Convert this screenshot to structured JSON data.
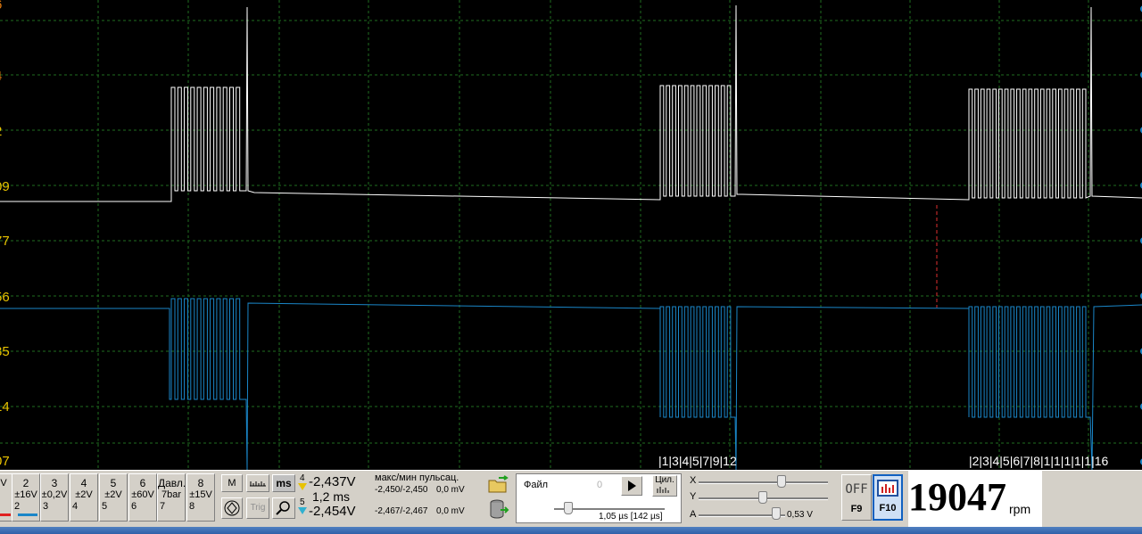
{
  "scope": {
    "y_labels": [
      "6",
      "4",
      "2",
      "09",
      "77",
      "56",
      "35",
      "14",
      "07"
    ],
    "marker_groups": [
      "|1|3|4|5|7|9|12",
      "|2|3|4|5|6|7|8|1|1|1|1|1|16"
    ],
    "colors": {
      "trace1": "#ffffff",
      "trace2": "#1a86c8",
      "grid": "#1f6e1f",
      "label": "#e8c200",
      "label_top": "#e07a10"
    }
  },
  "channels": [
    {
      "num": "",
      "range": "V",
      "idx": ""
    },
    {
      "num": "2",
      "range": "±16V",
      "idx": "2"
    },
    {
      "num": "3",
      "range": "±0,2V",
      "idx": "3"
    },
    {
      "num": "4",
      "range": "±2V",
      "idx": "4"
    },
    {
      "num": "5",
      "range": "±2V",
      "idx": "5"
    },
    {
      "num": "6",
      "range": "±60V",
      "idx": "6"
    },
    {
      "num": "Давл.",
      "range": "7bar",
      "idx": "7"
    },
    {
      "num": "8",
      "range": "±15V",
      "idx": "8"
    }
  ],
  "tools": {
    "m_label": "M",
    "ms_label": "ms",
    "trig_label": "Trig"
  },
  "measure": {
    "cursor1_num": "4",
    "cursor1_value": "-2,437V",
    "delta_time": "1,2 ms",
    "cursor2_num": "5",
    "cursor2_value": "-2,454V",
    "header": "макс/мин  пульсац.",
    "row1_minmax": "-2,450/-2,450",
    "row1_ripple": "0,0 mV",
    "row2_minmax": "-2,467/-2,467",
    "row2_ripple": "0,0 mV"
  },
  "file": {
    "label": "Файл",
    "counter": "0",
    "cycle_label": "Цил.",
    "timebase": "1,05 µs [142 µs]"
  },
  "sliders": {
    "x_label": "X",
    "y_label": "Y",
    "a_label": "A",
    "a_value": "0,53 V"
  },
  "f_keys": {
    "f9_state": "OFF",
    "f9_label": "F9",
    "f10_label": "F10"
  },
  "rpm": {
    "value": "19047",
    "unit": "rpm"
  }
}
